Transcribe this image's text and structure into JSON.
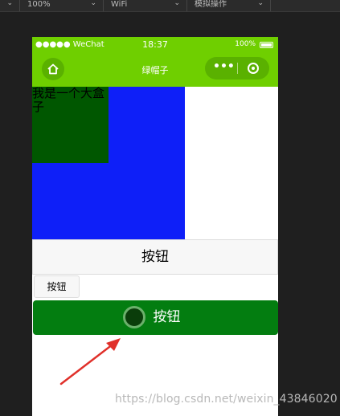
{
  "toolbar": {
    "zoom_value": "100%",
    "network_value": "WiFi",
    "mode_value": "模拟操作"
  },
  "status_bar": {
    "carrier": "●●●●● WeChat",
    "time": "18:37",
    "battery_percent": "100%"
  },
  "nav_bar": {
    "title": "绿帽子",
    "more_icon": "more-dots-icon",
    "close_icon": "target-circle-icon",
    "home_icon": "home-icon"
  },
  "content": {
    "inner_box_text": "我是一个大盒子",
    "button_default_label": "按钮",
    "button_mini_label": "按钮",
    "button_primary_label": "按钮"
  },
  "watermark": "https://blog.csdn.net/weixin_43846020",
  "colors": {
    "nav_green": "#6fcf00",
    "blue_box": "#0e1ff8",
    "dark_green_box": "#005700",
    "primary_button": "#037d10",
    "arrow_red": "#e0302a"
  }
}
